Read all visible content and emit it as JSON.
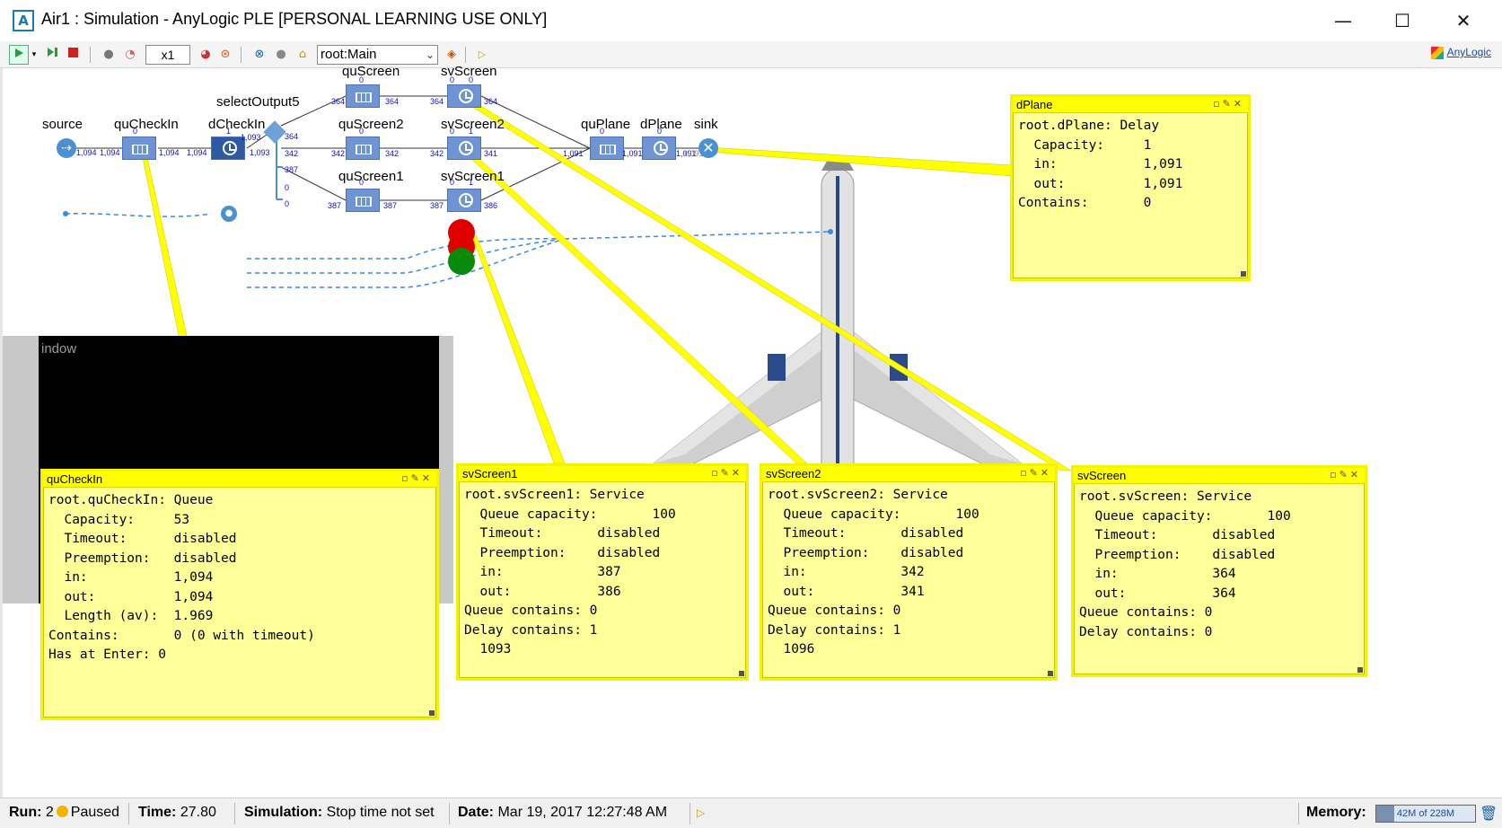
{
  "window": {
    "title": "Air1 : Simulation - AnyLogic PLE [PERSONAL LEARNING USE ONLY]",
    "app_icon": "anylogic-icon",
    "controls": {
      "minimize": "—",
      "maximize": "☐",
      "close": "✕"
    }
  },
  "toolbar": {
    "speed": "x1",
    "root_select": "root:Main",
    "brand": "AnyLogic"
  },
  "model": {
    "labels": {
      "source": "source",
      "quCheckIn": "quCheckIn",
      "dCheckIn": "dCheckIn",
      "selectOutput5": "selectOutput5",
      "quScreen": "quScreen",
      "svScreen": "svScreen",
      "quScreen2": "quScreen2",
      "svScreen2": "svScreen2",
      "quScreen1": "quScreen1",
      "svScreen1": "svScreen1",
      "quPlane": "quPlane",
      "dPlane": "dPlane",
      "sink": "sink"
    },
    "counts": {
      "src_out": "1,094",
      "qci_in": "1,094",
      "qci_top": "0",
      "qci_out": "1,094",
      "dci_in": "1,094",
      "dci_top": "1",
      "dci_out": "1,093",
      "so_in": "1,093",
      "so_out1": "364",
      "so_out2": "342",
      "so_out3": "387",
      "so_out4": "0",
      "so_out5": "0",
      "qs_in": "364",
      "qs_top": "0",
      "qs_out": "364",
      "ss_in": "364",
      "ss_top_a": "0",
      "ss_top_b": "0",
      "ss_out": "364",
      "qs2_in": "342",
      "qs2_top": "0",
      "qs2_out": "342",
      "ss2_in": "342",
      "ss2_top_a": "0",
      "ss2_top_b": "1",
      "ss2_out": "341",
      "qs1_in": "387",
      "qs1_top": "0",
      "qs1_out": "387",
      "ss1_in": "387",
      "ss1_top_a": "0",
      "ss1_top_b": "1",
      "ss1_out": "386",
      "qp_in": "1,091",
      "qp_top": "0",
      "qp_out": "1,091",
      "dp_top": "0",
      "dp_out": "1,091",
      "sink_in": "1,091"
    }
  },
  "black_window": {
    "title": "indow"
  },
  "popups": {
    "dPlane": {
      "title": "dPlane",
      "body": "root.dPlane: Delay\n  Capacity:     1\n  in:           1,091\n  out:          1,091\nContains:       0"
    },
    "quCheckIn": {
      "title": "quCheckIn",
      "body": "root.quCheckIn: Queue\n  Capacity:     53\n  Timeout:      disabled\n  Preemption:   disabled\n  in:           1,094\n  out:          1,094\n  Length (av):  1.969\nContains:       0 (0 with timeout)\nHas at Enter: 0"
    },
    "svScreen1": {
      "title": "svScreen1",
      "body": "root.svScreen1: Service\n  Queue capacity:       100\n  Timeout:       disabled\n  Preemption:    disabled\n  in:            387\n  out:           386\nQueue contains: 0\nDelay contains: 1\n  1093"
    },
    "svScreen2": {
      "title": "svScreen2",
      "body": "root.svScreen2: Service\n  Queue capacity:       100\n  Timeout:       disabled\n  Preemption:    disabled\n  in:            342\n  out:           341\nQueue contains: 0\nDelay contains: 1\n  1096"
    },
    "svScreen": {
      "title": "svScreen",
      "body": "root.svScreen: Service\n  Queue capacity:       100\n  Timeout:       disabled\n  Preemption:    disabled\n  in:            364\n  out:           364\nQueue contains: 0\nDelay contains: 0"
    }
  },
  "status": {
    "run_label": "Run:",
    "run_value": "2",
    "run_state": "Paused",
    "time_label": "Time:",
    "time_value": "27.80",
    "sim_label": "Simulation:",
    "sim_value": "Stop time not set",
    "date_label": "Date:",
    "date_value": "Mar 19, 2017 12:27:48 AM",
    "memory_label": "Memory:",
    "memory_value": "42M of 228M",
    "memory_fraction": 0.18
  },
  "colors": {
    "popup_bg": "#ffff99",
    "popup_border": "#ffff00",
    "block_blue": "#6f94d4",
    "link_blue": "#1010c0",
    "light_red": "#e00000",
    "light_green": "#0a8a0a"
  }
}
